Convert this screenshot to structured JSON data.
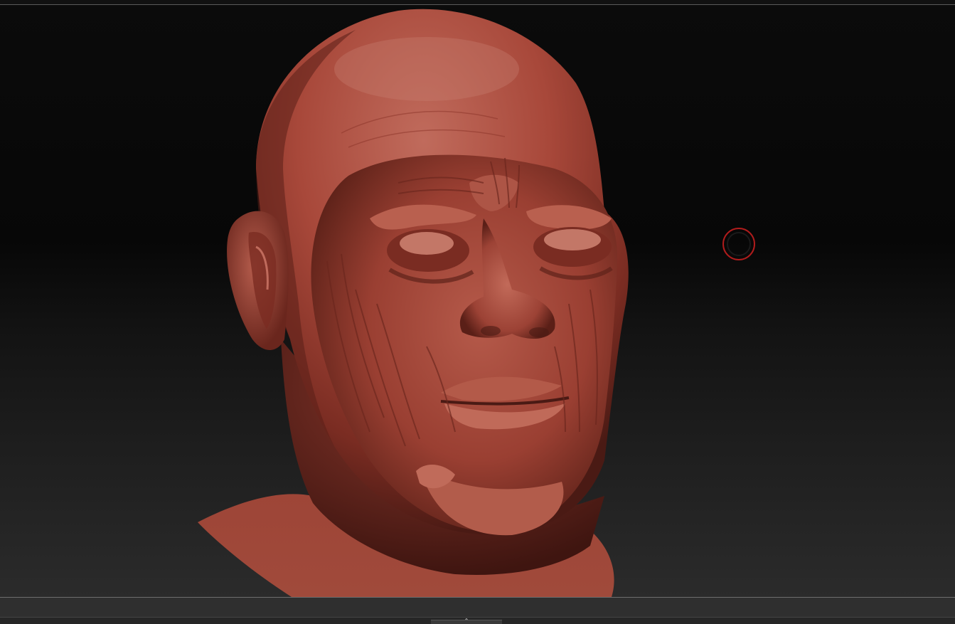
{
  "app": {
    "viewport": {
      "subject": "",
      "material_color": "#a8483a",
      "background_top": "#0b0b0b",
      "background_bottom": "#2b2b2b"
    },
    "brush_cursor": {
      "icon": "brush-circle-icon",
      "outer_color": "#b01c1c",
      "inner_color": "#1a1a1a"
    },
    "bottom_shelf": {
      "handle_icon": "collapse-toggle-icon",
      "handle_glyph": "⌃"
    }
  }
}
